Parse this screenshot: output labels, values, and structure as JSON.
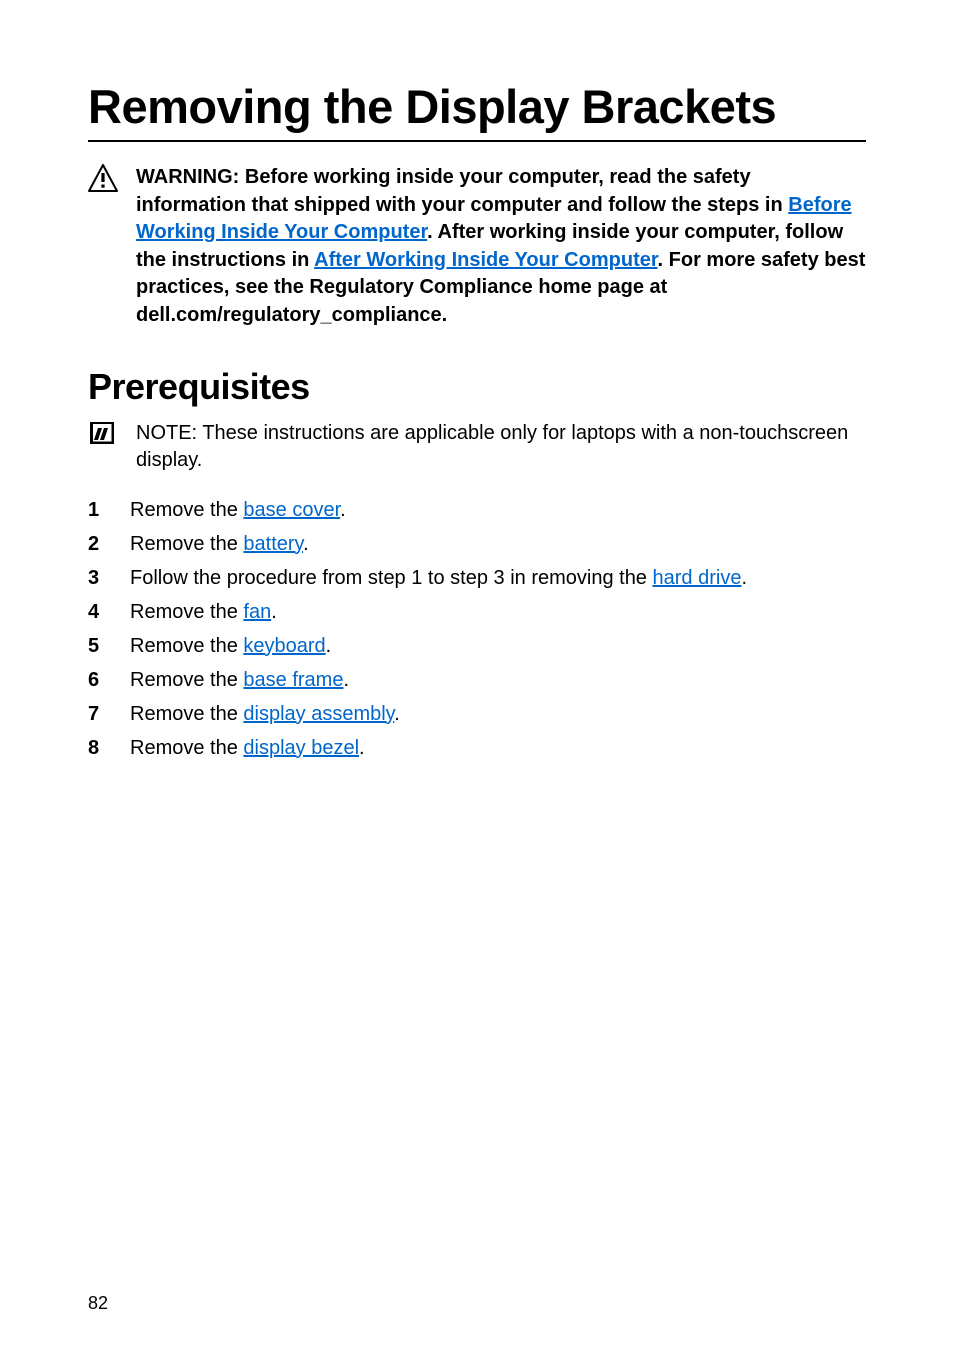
{
  "title": "Removing the Display Brackets",
  "warning": {
    "prefix": "WARNING: Before working inside your computer, read the safety information that shipped with your computer and follow the steps in ",
    "link1": "Before Working Inside Your Computer",
    "mid1": ". After working inside your computer, follow the instructions in ",
    "link2": "After Working Inside Your Computer",
    "suffix": ". For more safety best practices, see the Regulatory Compliance home page at dell.com/regulatory_compliance."
  },
  "section_heading": "Prerequisites",
  "note": {
    "label": "NOTE:",
    "text": " These instructions are applicable only for laptops with a non-touchscreen display."
  },
  "steps": [
    {
      "num": "1",
      "pre": "Remove the ",
      "link": "base cover",
      "post": "."
    },
    {
      "num": "2",
      "pre": "Remove the ",
      "link": "battery",
      "post": "."
    },
    {
      "num": "3",
      "pre": "Follow the procedure from step 1 to step 3 in removing the ",
      "link": "hard drive",
      "post": "."
    },
    {
      "num": "4",
      "pre": "Remove the ",
      "link": "fan",
      "post": "."
    },
    {
      "num": "5",
      "pre": "Remove the ",
      "link": "keyboard",
      "post": "."
    },
    {
      "num": "6",
      "pre": "Remove the ",
      "link": "base frame",
      "post": "."
    },
    {
      "num": "7",
      "pre": "Remove the ",
      "link": "display assembly",
      "post": "."
    },
    {
      "num": "8",
      "pre": "Remove the ",
      "link": "display bezel",
      "post": "."
    }
  ],
  "page_number": "82"
}
